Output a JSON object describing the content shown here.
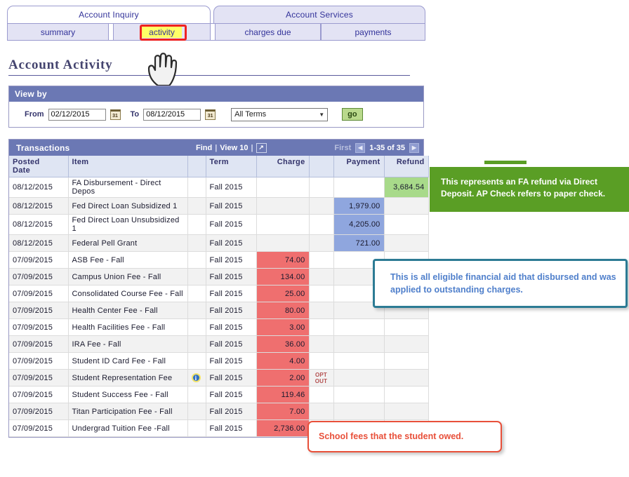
{
  "tabs": {
    "main": [
      {
        "label": "Account Inquiry",
        "active": true
      },
      {
        "label": "Account Services",
        "active": false
      }
    ],
    "sub": [
      {
        "label": "summary",
        "active": false
      },
      {
        "label": "activity",
        "active": true
      },
      {
        "label": "charges due",
        "active": false
      },
      {
        "label": "payments",
        "active": false
      }
    ]
  },
  "page": {
    "title": "Account Activity"
  },
  "viewby": {
    "header": "View by",
    "from_label": "From",
    "from_value": "02/12/2015",
    "to_label": "To",
    "to_value": "08/12/2015",
    "term_selected": "All Terms",
    "go_label": "go",
    "calendar_icon": "calendar-icon",
    "calendar_glyph": "31"
  },
  "grid": {
    "title": "Transactions",
    "find_label": "Find",
    "view_label": "View 10",
    "separator": "|",
    "expand_icon": "expand-icon",
    "expand_glyph": "↗",
    "first_label": "First",
    "prev_glyph": "◀",
    "next_glyph": "▶",
    "count_label": "1-35 of 35",
    "columns": [
      "Posted Date",
      "Item",
      "",
      "Term",
      "Charge",
      "",
      "Payment",
      "Refund"
    ],
    "column_posted_line1": "Posted",
    "column_posted_line2": "Date",
    "rows": [
      {
        "date": "08/12/2015",
        "item": "FA Disbursement - Direct Depos",
        "info": false,
        "term": "Fall 2015",
        "charge": "",
        "flag": "",
        "payment": "",
        "refund": "3,684.54",
        "hl": "refund",
        "alt": false
      },
      {
        "date": "08/12/2015",
        "item": "Fed Direct Loan Subsidized 1",
        "info": false,
        "term": "Fall 2015",
        "charge": "",
        "flag": "",
        "payment": "1,979.00",
        "refund": "",
        "hl": "payment",
        "alt": true
      },
      {
        "date": "08/12/2015",
        "item": "Fed Direct Loan Unsubsidized 1",
        "info": false,
        "term": "Fall 2015",
        "charge": "",
        "flag": "",
        "payment": "4,205.00",
        "refund": "",
        "hl": "payment",
        "alt": false
      },
      {
        "date": "08/12/2015",
        "item": "Federal Pell Grant",
        "info": false,
        "term": "Fall 2015",
        "charge": "",
        "flag": "",
        "payment": "721.00",
        "refund": "",
        "hl": "payment",
        "alt": true
      },
      {
        "date": "07/09/2015",
        "item": "ASB Fee - Fall",
        "info": false,
        "term": "Fall 2015",
        "charge": "74.00",
        "flag": "",
        "payment": "",
        "refund": "",
        "hl": "charge",
        "alt": false
      },
      {
        "date": "07/09/2015",
        "item": "Campus Union Fee - Fall",
        "info": false,
        "term": "Fall 2015",
        "charge": "134.00",
        "flag": "",
        "payment": "",
        "refund": "",
        "hl": "charge",
        "alt": true
      },
      {
        "date": "07/09/2015",
        "item": "Consolidated Course Fee - Fall",
        "info": false,
        "term": "Fall 2015",
        "charge": "25.00",
        "flag": "",
        "payment": "",
        "refund": "",
        "hl": "charge",
        "alt": false
      },
      {
        "date": "07/09/2015",
        "item": "Health Center Fee - Fall",
        "info": false,
        "term": "Fall 2015",
        "charge": "80.00",
        "flag": "",
        "payment": "",
        "refund": "",
        "hl": "charge",
        "alt": true
      },
      {
        "date": "07/09/2015",
        "item": "Health Facilities Fee - Fall",
        "info": false,
        "term": "Fall 2015",
        "charge": "3.00",
        "flag": "",
        "payment": "",
        "refund": "",
        "hl": "charge",
        "alt": false
      },
      {
        "date": "07/09/2015",
        "item": "IRA Fee - Fall",
        "info": false,
        "term": "Fall 2015",
        "charge": "36.00",
        "flag": "",
        "payment": "",
        "refund": "",
        "hl": "charge",
        "alt": true
      },
      {
        "date": "07/09/2015",
        "item": "Student ID Card Fee - Fall",
        "info": false,
        "term": "Fall 2015",
        "charge": "4.00",
        "flag": "",
        "payment": "",
        "refund": "",
        "hl": "charge",
        "alt": false
      },
      {
        "date": "07/09/2015",
        "item": "Student Representation Fee",
        "info": true,
        "term": "Fall 2015",
        "charge": "2.00",
        "flag": "OPT OUT",
        "payment": "",
        "refund": "",
        "hl": "charge",
        "alt": true
      },
      {
        "date": "07/09/2015",
        "item": "Student Success Fee - Fall",
        "info": false,
        "term": "Fall 2015",
        "charge": "119.46",
        "flag": "",
        "payment": "",
        "refund": "",
        "hl": "charge",
        "alt": false
      },
      {
        "date": "07/09/2015",
        "item": "Titan Participation Fee - Fall",
        "info": false,
        "term": "Fall 2015",
        "charge": "7.00",
        "flag": "",
        "payment": "",
        "refund": "",
        "hl": "charge",
        "alt": true
      },
      {
        "date": "07/09/2015",
        "item": "Undergrad Tuition Fee -Fall",
        "info": false,
        "term": "Fall 2015",
        "charge": "2,736.00",
        "flag": "",
        "payment": "",
        "refund": "",
        "hl": "charge",
        "alt": false
      }
    ]
  },
  "callouts": {
    "green": "This represents an FA refund via Direct Deposit. AP Check refers to paper check.",
    "blue": "This is all eligible financial aid that disbursed and was applied to outstanding charges.",
    "red": "School fees that the student owed."
  },
  "colors": {
    "header_blue": "#6b78b4",
    "charge_red": "#ef6f6f",
    "payment_blue": "#8fa6de",
    "refund_green": "#a8da8a",
    "callout_green": "#5a9e25",
    "callout_blue_border": "#2c7b94",
    "callout_red_border": "#e8503a",
    "highlight_yellow": "#ffff66",
    "focus_red": "#ee2222"
  }
}
